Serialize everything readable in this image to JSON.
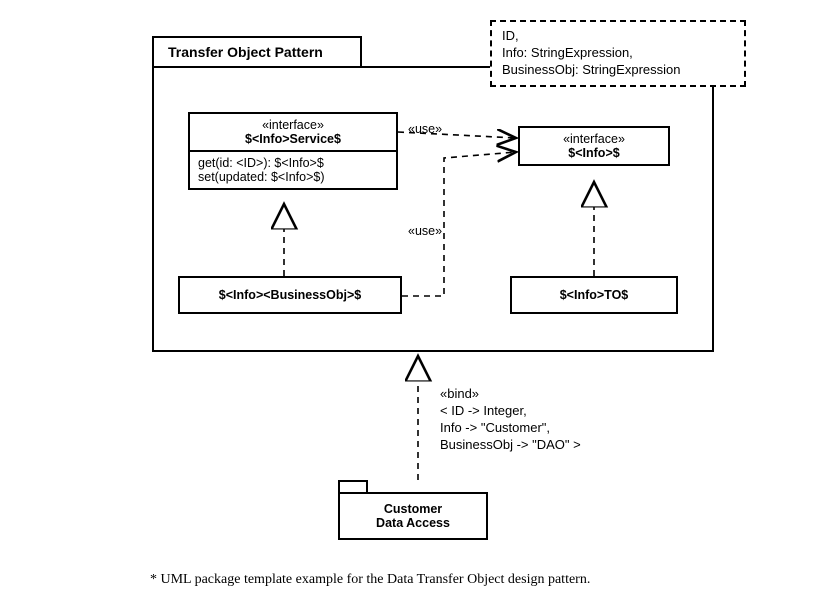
{
  "package": {
    "title": "Transfer Object Pattern"
  },
  "params": {
    "line1": "ID,",
    "line2": "Info: StringExpression,",
    "line3": "BusinessObj: StringExpression"
  },
  "service": {
    "stereotype": "«interface»",
    "name": "$<Info>Service$",
    "op1": "get(id: <ID>): $<Info>$",
    "op2": "set(updated: $<Info>$)"
  },
  "info": {
    "stereotype": "«interface»",
    "name": "$<Info>$"
  },
  "businessObj": {
    "name": "$<Info><BusinessObj>$"
  },
  "to": {
    "name": "$<Info>TO$"
  },
  "uses": {
    "use1": "«use»",
    "use2": "«use»"
  },
  "bind": {
    "stereotype": "«bind»",
    "line1": "< ID -> Integer,",
    "line2": "Info -> \"Customer\",",
    "line3": "BusinessObj -> \"DAO\" >"
  },
  "customer": {
    "line1": "Customer",
    "line2": "Data Access"
  },
  "caption": "* UML package template example for the Data Transfer Object design pattern."
}
